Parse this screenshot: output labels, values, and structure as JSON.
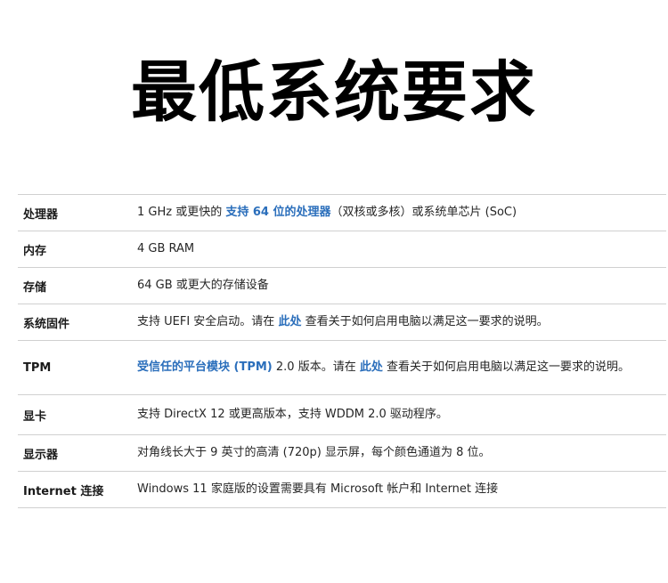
{
  "page": {
    "title": "最低系统要求"
  },
  "requirements": [
    {
      "label": "处理器",
      "value": [
        {
          "text": "1 GHz 或更快的 "
        },
        {
          "text": "支持 64 位的处理器",
          "link": true
        },
        {
          "text": "（双核或多核）或系统单芯片 (SoC)"
        }
      ]
    },
    {
      "label": "内存",
      "value": [
        {
          "text": "4 GB RAM"
        }
      ]
    },
    {
      "label": "存储",
      "value": [
        {
          "text": "64 GB 或更大的存储设备"
        }
      ]
    },
    {
      "label": "系统固件",
      "value": [
        {
          "text": "支持 UEFI 安全启动。请在 "
        },
        {
          "text": "此处",
          "link": true
        },
        {
          "text": " 查看关于如何启用电脑以满足这一要求的说明。"
        }
      ]
    },
    {
      "label": "TPM",
      "value": [
        {
          "text": "受信任的平台模块 (TPM)",
          "link": true
        },
        {
          "text": " 2.0 版本。请在 "
        },
        {
          "text": "此处",
          "link": true
        },
        {
          "text": " 查看关于如何启用电脑以满足这一要求的说明。"
        }
      ]
    },
    {
      "label": "显卡",
      "value": [
        {
          "text": "支持 DirectX 12 或更高版本，支持 WDDM 2.0 驱动程序。"
        }
      ]
    },
    {
      "label": "显示器",
      "value": [
        {
          "text": "对角线长大于 9 英寸的高清 (720p) 显示屏，每个颜色通道为 8 位。"
        }
      ]
    },
    {
      "label": "Internet 连接",
      "value": [
        {
          "text": "Windows 11 家庭版的设置需要具有 Microsoft 帐户和 Internet 连接"
        }
      ]
    }
  ],
  "colors": {
    "link": "#2a6ebb",
    "divider": "#d0d0d0",
    "title": "#000000"
  }
}
